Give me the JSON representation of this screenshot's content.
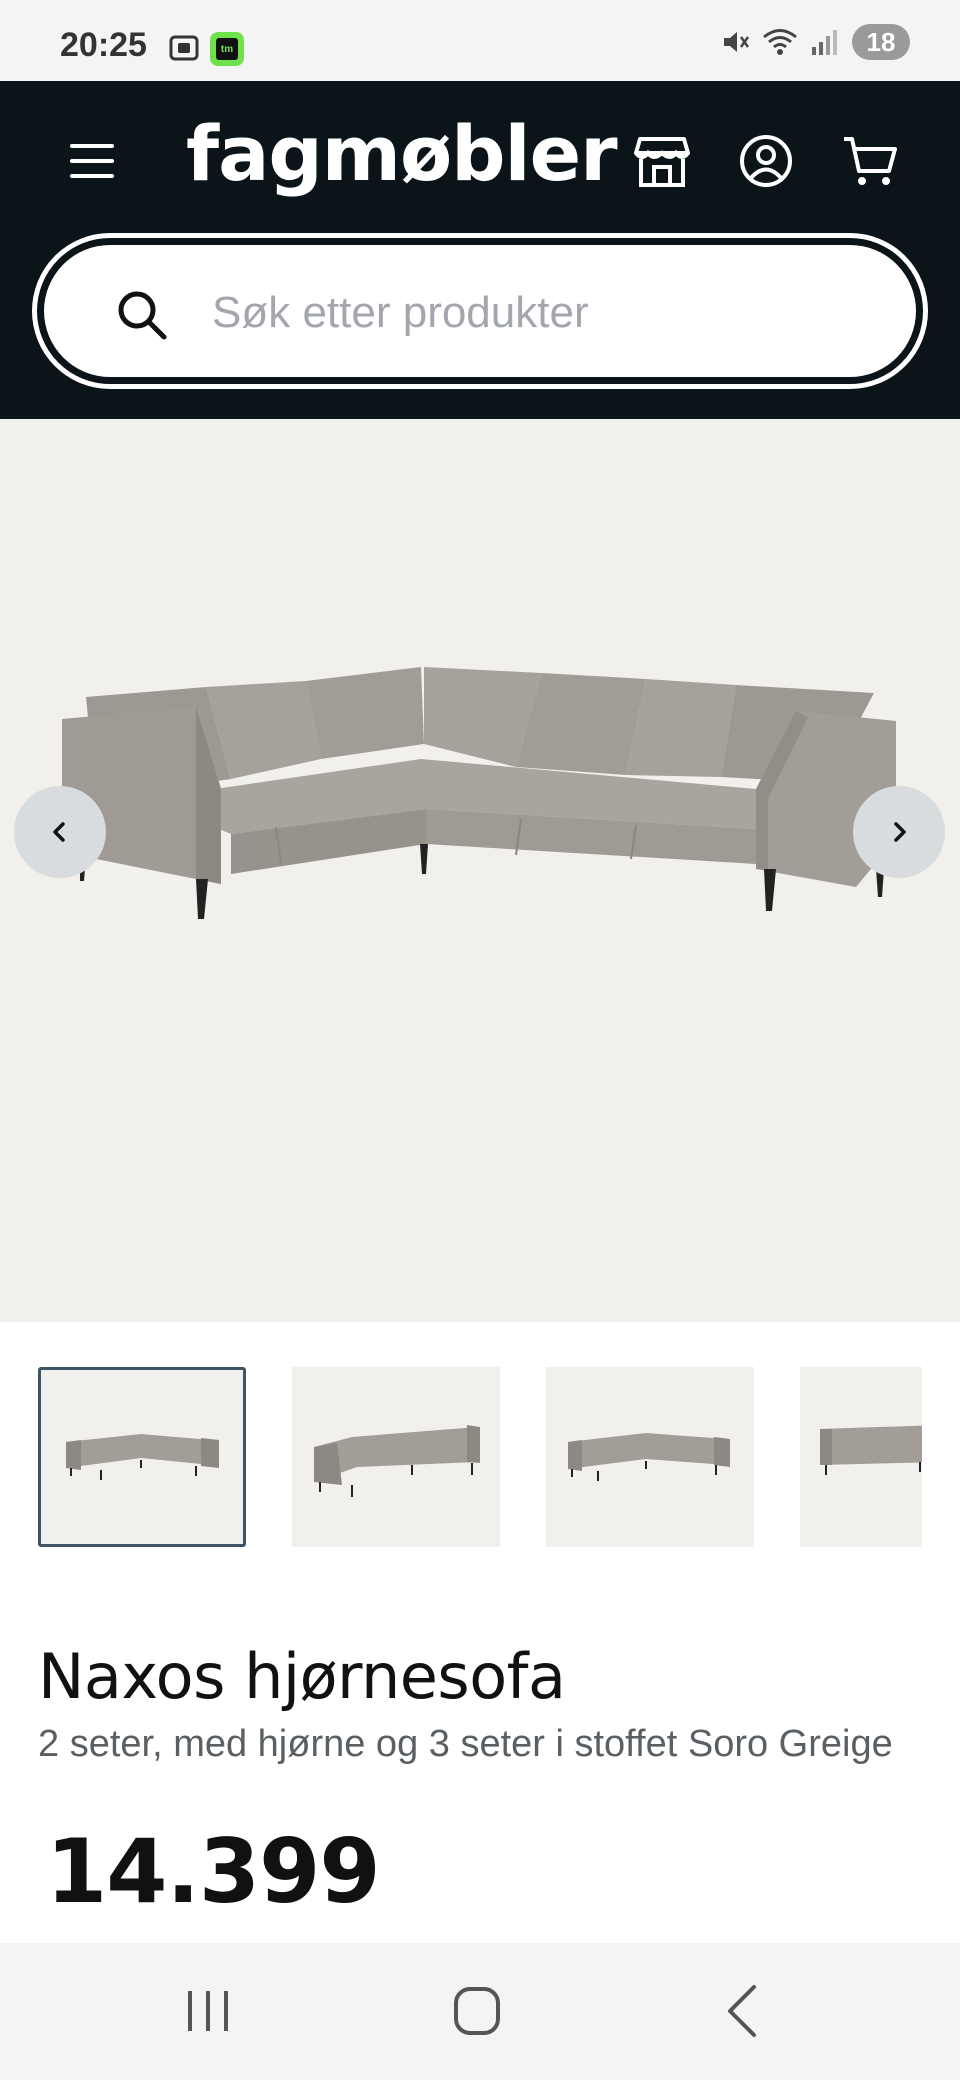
{
  "status_bar": {
    "time": "20:25",
    "app_badge": "tm",
    "battery": "18"
  },
  "header": {
    "brand": "fagmøbler",
    "search": {
      "placeholder": "Søk etter produkter",
      "value": ""
    }
  },
  "icons": {
    "menu": "menu-icon",
    "store": "store-icon",
    "account": "user-icon",
    "cart": "cart-icon",
    "search": "search-icon",
    "prev": "chevron-left-icon",
    "next": "chevron-right-icon"
  },
  "gallery": {
    "active_index": 0,
    "thumbnail_count_visible": 4
  },
  "product": {
    "title": "Naxos hjørnesofa",
    "subtitle": "2 seter, med hjørne og 3 seter i stoffet Soro Greige",
    "price": "14.399"
  },
  "colors": {
    "header_bg": "#0b1419",
    "image_bg": "#f2f0ed",
    "thumb_active_border": "#3b5566",
    "sofa_fabric": "#a39d97"
  }
}
